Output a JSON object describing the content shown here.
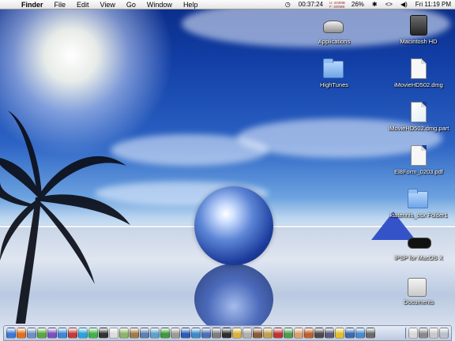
{
  "menubar": {
    "apple_glyph": "",
    "items": [
      {
        "label": "Finder",
        "bold": true
      },
      {
        "label": "File"
      },
      {
        "label": "Edit"
      },
      {
        "label": "View"
      },
      {
        "label": "Go"
      },
      {
        "label": "Window"
      },
      {
        "label": "Help"
      }
    ],
    "status": {
      "timer": "00:37:24",
      "mem_used": "U: 203MB",
      "mem_free": "F: 309MB",
      "battery": "26%",
      "bluetooth_glyph": "✱",
      "sync_glyph": "<>",
      "volume_glyph": "◀)",
      "clock": "Fri 11:19 PM"
    }
  },
  "desktop_icons": [
    {
      "name": "applications",
      "label": "Applications",
      "icon": "app-icon"
    },
    {
      "name": "macintosh-hd",
      "label": "Macintosh HD",
      "icon": "hard-drive-icon"
    },
    {
      "name": "hightunes",
      "label": "HighTunes",
      "icon": "folder-icon"
    },
    {
      "name": "imoviehd502-dmg",
      "label": "iMovieHD502.dmg",
      "icon": "disk-image-icon"
    },
    {
      "name": "imoviehd502-dmg-part",
      "label": "iMovieHD502.dmg.part",
      "icon": "partial-download-icon"
    },
    {
      "name": "el8form-pdf",
      "label": "El8Form_0203.pdf",
      "icon": "pdf-document-icon"
    },
    {
      "name": "ktatennis-folder",
      "label": "ktatennis_osx Folder1",
      "icon": "folder-icon"
    },
    {
      "name": "ipsp-for-macosx",
      "label": "iPSP for MacOS X",
      "icon": "psp-icon"
    },
    {
      "name": "documents",
      "label": "Documents",
      "icon": "documents-icon"
    }
  ],
  "dock": {
    "items": [
      {
        "icon": "finder-icon",
        "color": "#3b78d8"
      },
      {
        "icon": "firefox-icon",
        "color": "#e0701f"
      },
      {
        "icon": "mail-icon",
        "color": "#6f8fbf"
      },
      {
        "icon": "ichat-icon",
        "color": "#58a83f"
      },
      {
        "icon": "itunes-icon",
        "color": "#7a4fbf"
      },
      {
        "icon": "safari-icon",
        "color": "#3d87d6"
      },
      {
        "icon": "calendar-icon",
        "color": "#c33b3b"
      },
      {
        "icon": "skype-icon",
        "color": "#2aa3d9"
      },
      {
        "icon": "green-s-icon",
        "color": "#3fb34a"
      },
      {
        "icon": "terminal-icon",
        "color": "#333333"
      },
      {
        "icon": "textedit-icon",
        "color": "#dcdcdc"
      },
      {
        "icon": "preview-icon",
        "color": "#8bb36b"
      },
      {
        "icon": "address-book-icon",
        "color": "#a07a4a"
      },
      {
        "icon": "photo-icon",
        "color": "#5a7fb0"
      },
      {
        "icon": "iphoto-icon",
        "color": "#5ea0c8"
      },
      {
        "icon": "dreamweaver-icon",
        "color": "#3f9a3f"
      },
      {
        "icon": "utility-icon",
        "color": "#9a9a9a"
      },
      {
        "icon": "word-icon",
        "color": "#2a5cb8"
      },
      {
        "icon": "globe-icon",
        "color": "#3b8bc8"
      },
      {
        "icon": "quicktime-icon",
        "color": "#4a6fb3"
      },
      {
        "icon": "system-prefs-icon",
        "color": "#7d7d7d"
      },
      {
        "icon": "gamepad-icon",
        "color": "#2e2e2e"
      },
      {
        "icon": "bolt-icon",
        "color": "#d8b23a"
      },
      {
        "icon": "disk-utility-icon",
        "color": "#b0b0b0"
      },
      {
        "icon": "font-book-icon",
        "color": "#8a5a3a"
      },
      {
        "icon": "keychain-icon",
        "color": "#c0a050"
      },
      {
        "icon": "acrobat-icon",
        "color": "#c23232"
      },
      {
        "icon": "activity-icon",
        "color": "#4f9a4f"
      },
      {
        "icon": "hand-icon",
        "color": "#d8a070"
      },
      {
        "icon": "graphic-icon",
        "color": "#c06030"
      },
      {
        "icon": "chess-icon",
        "color": "#4a4a4a"
      },
      {
        "icon": "camera-icon",
        "color": "#5a5a7a"
      },
      {
        "icon": "sun-icon",
        "color": "#e0c030"
      },
      {
        "icon": "dashboard-icon",
        "color": "#3a6ab0"
      },
      {
        "icon": "help-icon",
        "color": "#4a8ad0"
      },
      {
        "icon": "console-icon",
        "color": "#6a6a6a"
      }
    ],
    "right_items": [
      {
        "icon": "document-stack-icon",
        "color": "#d8d8d8"
      },
      {
        "icon": "gun-icon",
        "color": "#8a8a8a"
      },
      {
        "icon": "window-icon",
        "color": "#c8c8c8"
      },
      {
        "icon": "trash-icon",
        "color": "#b8c0cc"
      }
    ]
  }
}
